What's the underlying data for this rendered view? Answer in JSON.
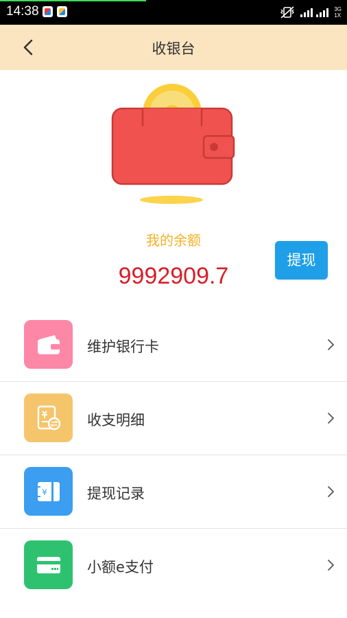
{
  "status_bar": {
    "time": "14:38",
    "network_top": "3G",
    "network_bottom": "1X"
  },
  "header": {
    "title": "收银台"
  },
  "wallet": {
    "balance_label": "我的余额",
    "balance_value": "9992909.7",
    "withdraw_label": "提现"
  },
  "menu": {
    "items": [
      {
        "label": "维护银行卡",
        "icon": "wallet-icon",
        "color": "#fd87a7"
      },
      {
        "label": "收支明细",
        "icon": "ledger-icon",
        "color": "#f5c56c"
      },
      {
        "label": "提现记录",
        "icon": "cash-record-icon",
        "color": "#3b9ef0"
      },
      {
        "label": "小额e支付",
        "icon": "card-icon",
        "color": "#2ec270"
      }
    ]
  },
  "colors": {
    "header_bg": "#fbe5c0",
    "balance_label": "#f3b128",
    "balance_value": "#d81e26",
    "button_bg": "#1e9fe8"
  }
}
